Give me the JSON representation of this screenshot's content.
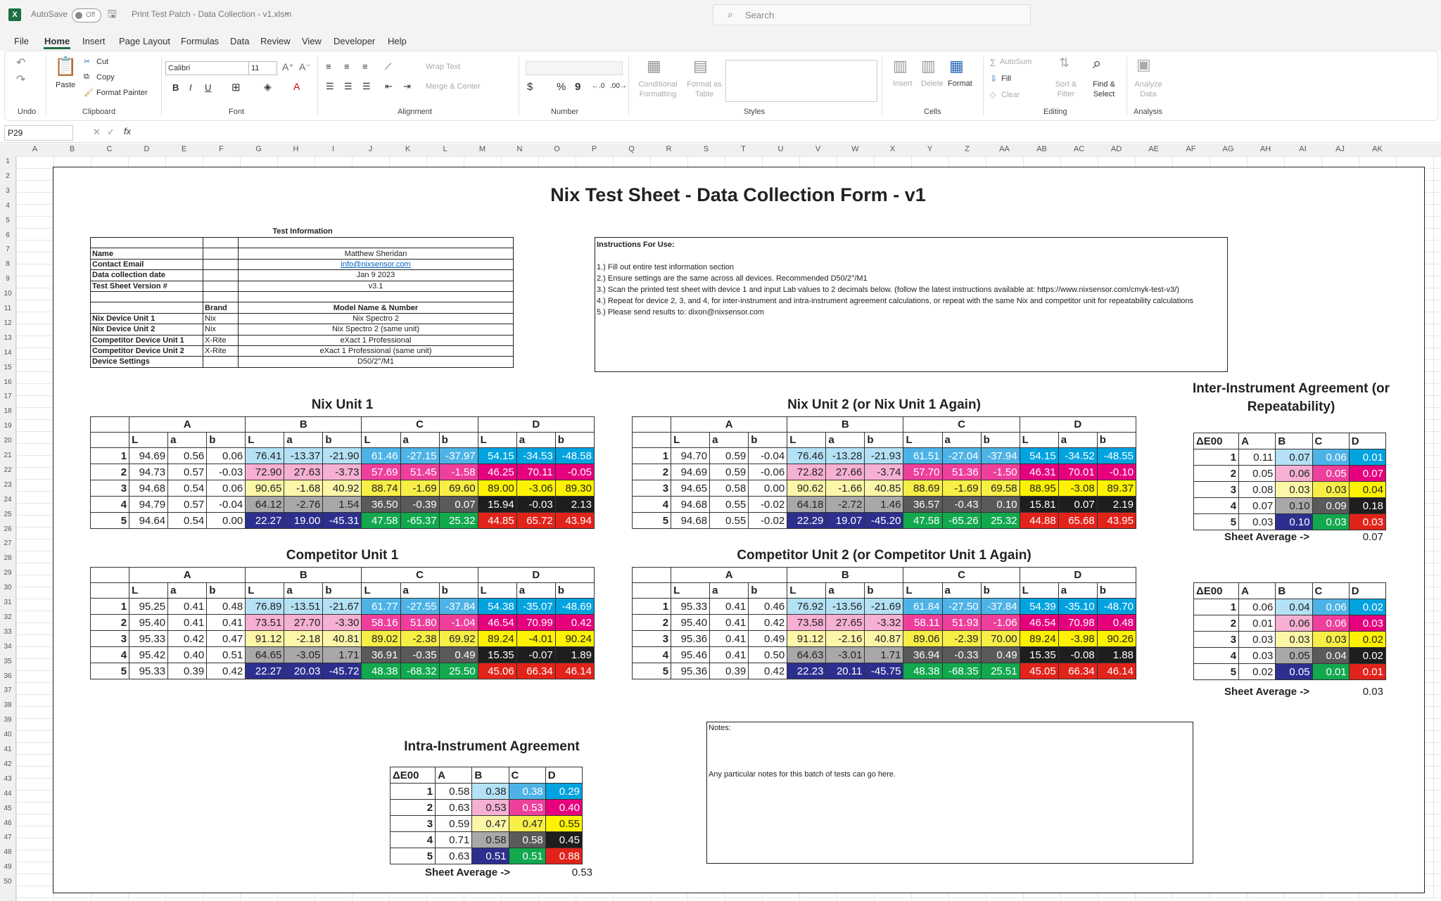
{
  "window": {
    "autosave_label": "AutoSave",
    "autosave_state": "Off",
    "file_name": "Print Test Patch - Data Collection - v1.xlsm",
    "search_placeholder": "Search"
  },
  "menu": [
    "File",
    "Home",
    "Insert",
    "Page Layout",
    "Formulas",
    "Data",
    "Review",
    "View",
    "Developer",
    "Help"
  ],
  "ribbon": {
    "undo_group": "Undo",
    "clipboard": {
      "paste": "Paste",
      "cut": "Cut",
      "copy": "Copy",
      "format_painter": "Format Painter",
      "label": "Clipboard"
    },
    "font": {
      "name": "Calibri",
      "size": "11",
      "label": "Font"
    },
    "alignment": {
      "wrap": "Wrap Text",
      "merge": "Merge & Center",
      "label": "Alignment"
    },
    "number": {
      "label": "Number",
      "currency": "$",
      "percent": "%",
      "comma": "9"
    },
    "styles": {
      "conditional": "Conditional Formatting",
      "format_table": "Format as Table",
      "label": "Styles"
    },
    "cells": {
      "insert": "Insert",
      "delete": "Delete",
      "format": "Format",
      "label": "Cells"
    },
    "editing": {
      "autosum": "AutoSum",
      "fill": "Fill",
      "clear": "Clear",
      "sort": "Sort & Filter",
      "find": "Find & Select",
      "label": "Editing"
    },
    "analysis": {
      "analyze": "Analyze Data",
      "label": "Analysis"
    }
  },
  "formula_bar": {
    "cell_ref": "P29",
    "fx": "fx",
    "value": ""
  },
  "columns": [
    "A",
    "B",
    "C",
    "D",
    "E",
    "F",
    "G",
    "H",
    "I",
    "J",
    "K",
    "L",
    "M",
    "N",
    "O",
    "P",
    "Q",
    "R",
    "S",
    "T",
    "U",
    "V",
    "W",
    "X",
    "Y",
    "Z",
    "AA",
    "AB",
    "AC",
    "AD",
    "AE",
    "AF",
    "AG",
    "AH",
    "AI",
    "AJ",
    "AK"
  ],
  "sheet": {
    "title": "Nix Test Sheet - Data Collection Form - v1",
    "test_info": {
      "heading": "Test Information",
      "name_label": "Name",
      "name": "Matthew Sheridan",
      "email_label": "Contact Email",
      "email": "info@nixsensor.com",
      "date_label": "Data collection date",
      "date": "Jan 9 2023",
      "version_label": "Test Sheet Version #",
      "version": "v3.1",
      "brand_head": "Brand",
      "model_head": "Model Name & Number",
      "devices": [
        {
          "label": "Nix Device Unit 1",
          "brand": "Nix",
          "model": "Nix Spectro 2"
        },
        {
          "label": "Nix Device Unit 2",
          "brand": "Nix",
          "model": "Nix Spectro 2 (same unit)"
        },
        {
          "label": "Competitor Device Unit 1",
          "brand": "X-Rite",
          "model": "eXact 1 Professional"
        },
        {
          "label": "Competitor Device Unit 2",
          "brand": "X-Rite",
          "model": "eXact 1 Professional  (same unit)"
        }
      ],
      "settings_label": "Device Settings",
      "settings": "D50/2°/M1"
    },
    "instructions": {
      "heading": "Instructions For Use:",
      "lines": [
        "1.) Fill out entire test information section",
        "2.) Ensure  settings are the same across all devices. Recommended D50/2°/M1",
        "3.) Scan the printed test sheet with device 1 and input Lab values to 2 decimals below. (follow the latest instructions available at: https://www.nixsensor.com/cmyk-test-v3/)",
        "4.) Repeat for device 2, 3, and 4, for inter-instrument and intra-instrument agreement calculations, or repeat with the same Nix and competitor unit for repeatability calculations",
        "5.) Please send results to: dixon@nixsensor.com"
      ]
    },
    "groups": [
      "A",
      "B",
      "C",
      "D"
    ],
    "lab_headers": [
      "L",
      "a",
      "b"
    ],
    "tables": [
      {
        "title": "Nix Unit 1",
        "rows": [
          [
            "1",
            "94.69",
            "0.56",
            "0.06",
            "76.41",
            "-13.37",
            "-21.90",
            "61.46",
            "-27.15",
            "-37.97",
            "54.15",
            "-34.53",
            "-48.58"
          ],
          [
            "2",
            "94.73",
            "0.57",
            "-0.03",
            "72.90",
            "27.63",
            "-3.73",
            "57.69",
            "51.45",
            "-1.58",
            "46.25",
            "70.11",
            "-0.05"
          ],
          [
            "3",
            "94.68",
            "0.54",
            "0.06",
            "90.65",
            "-1.68",
            "40.92",
            "88.74",
            "-1.69",
            "69.60",
            "89.00",
            "-3.06",
            "89.30"
          ],
          [
            "4",
            "94.79",
            "0.57",
            "-0.04",
            "64.12",
            "-2.76",
            "1.54",
            "36.50",
            "-0.39",
            "0.07",
            "15.94",
            "-0.03",
            "2.13"
          ],
          [
            "5",
            "94.64",
            "0.54",
            "0.00",
            "22.27",
            "19.00",
            "-45.31",
            "47.58",
            "-65.37",
            "25.32",
            "44.85",
            "65.72",
            "43.94"
          ]
        ]
      },
      {
        "title": "Nix Unit 2 (or Nix Unit 1 Again)",
        "rows": [
          [
            "1",
            "94.70",
            "0.59",
            "-0.04",
            "76.46",
            "-13.28",
            "-21.93",
            "61.51",
            "-27.04",
            "-37.94",
            "54.15",
            "-34.52",
            "-48.55"
          ],
          [
            "2",
            "94.69",
            "0.59",
            "-0.06",
            "72.82",
            "27.66",
            "-3.74",
            "57.70",
            "51.36",
            "-1.50",
            "46.31",
            "70.01",
            "-0.10"
          ],
          [
            "3",
            "94.65",
            "0.58",
            "0.00",
            "90.62",
            "-1.66",
            "40.85",
            "88.69",
            "-1.69",
            "69.58",
            "88.95",
            "-3.08",
            "89.37"
          ],
          [
            "4",
            "94.68",
            "0.55",
            "-0.02",
            "64.18",
            "-2.72",
            "1.46",
            "36.57",
            "-0.43",
            "0.10",
            "15.81",
            "0.07",
            "2.19"
          ],
          [
            "5",
            "94.68",
            "0.55",
            "-0.02",
            "22.29",
            "19.07",
            "-45.20",
            "47.58",
            "-65.26",
            "25.32",
            "44.88",
            "65.68",
            "43.95"
          ]
        ]
      },
      {
        "title": "Competitor Unit 1",
        "rows": [
          [
            "1",
            "95.25",
            "0.41",
            "0.48",
            "76.89",
            "-13.51",
            "-21.67",
            "61.77",
            "-27.55",
            "-37.84",
            "54.38",
            "-35.07",
            "-48.69"
          ],
          [
            "2",
            "95.40",
            "0.41",
            "0.41",
            "73.51",
            "27.70",
            "-3.30",
            "58.16",
            "51.80",
            "-1.04",
            "46.54",
            "70.99",
            "0.42"
          ],
          [
            "3",
            "95.33",
            "0.42",
            "0.47",
            "91.12",
            "-2.18",
            "40.81",
            "89.02",
            "-2.38",
            "69.92",
            "89.24",
            "-4.01",
            "90.24"
          ],
          [
            "4",
            "95.42",
            "0.40",
            "0.51",
            "64.65",
            "-3.05",
            "1.71",
            "36.91",
            "-0.35",
            "0.49",
            "15.35",
            "-0.07",
            "1.89"
          ],
          [
            "5",
            "95.33",
            "0.39",
            "0.42",
            "22.27",
            "20.03",
            "-45.72",
            "48.38",
            "-68.32",
            "25.50",
            "45.06",
            "66.34",
            "46.14"
          ]
        ]
      },
      {
        "title": "Competitor Unit 2 (or Competitor Unit 1 Again)",
        "rows": [
          [
            "1",
            "95.33",
            "0.41",
            "0.46",
            "76.92",
            "-13.56",
            "-21.69",
            "61.84",
            "-27.50",
            "-37.84",
            "54.39",
            "-35.10",
            "-48.70"
          ],
          [
            "2",
            "95.40",
            "0.41",
            "0.42",
            "73.58",
            "27.65",
            "-3.32",
            "58.11",
            "51.93",
            "-1.06",
            "46.54",
            "70.98",
            "0.48"
          ],
          [
            "3",
            "95.36",
            "0.41",
            "0.49",
            "91.12",
            "-2.16",
            "40.87",
            "89.06",
            "-2.39",
            "70.00",
            "89.24",
            "-3.98",
            "90.26"
          ],
          [
            "4",
            "95.46",
            "0.41",
            "0.50",
            "64.63",
            "-3.01",
            "1.71",
            "36.94",
            "-0.33",
            "0.49",
            "15.35",
            "-0.08",
            "1.88"
          ],
          [
            "5",
            "95.36",
            "0.39",
            "0.42",
            "22.23",
            "20.11",
            "-45.75",
            "48.38",
            "-68.35",
            "25.51",
            "45.05",
            "66.34",
            "46.14"
          ]
        ]
      }
    ],
    "inter": {
      "title": "Inter-Instrument Agreement (or Repeatability)",
      "de_head": "ΔE00",
      "rows1": [
        [
          "1",
          "0.11",
          "0.07",
          "0.06",
          "0.01"
        ],
        [
          "2",
          "0.05",
          "0.06",
          "0.05",
          "0.07"
        ],
        [
          "3",
          "0.08",
          "0.03",
          "0.03",
          "0.04"
        ],
        [
          "4",
          "0.07",
          "0.10",
          "0.09",
          "0.18"
        ],
        [
          "5",
          "0.03",
          "0.10",
          "0.03",
          "0.03"
        ]
      ],
      "avg_label": "Sheet Average ->",
      "avg1": "0.07",
      "rows2": [
        [
          "1",
          "0.06",
          "0.04",
          "0.06",
          "0.02"
        ],
        [
          "2",
          "0.01",
          "0.06",
          "0.06",
          "0.03"
        ],
        [
          "3",
          "0.03",
          "0.03",
          "0.03",
          "0.02"
        ],
        [
          "4",
          "0.03",
          "0.05",
          "0.04",
          "0.02"
        ],
        [
          "5",
          "0.02",
          "0.05",
          "0.01",
          "0.01"
        ]
      ],
      "avg2": "0.03"
    },
    "intra": {
      "title": "Intra-Instrument Agreement",
      "de_head": "ΔE00",
      "rows": [
        [
          "1",
          "0.58",
          "0.38",
          "0.38",
          "0.29"
        ],
        [
          "2",
          "0.63",
          "0.53",
          "0.53",
          "0.40"
        ],
        [
          "3",
          "0.59",
          "0.47",
          "0.47",
          "0.55"
        ],
        [
          "4",
          "0.71",
          "0.58",
          "0.58",
          "0.45"
        ],
        [
          "5",
          "0.63",
          "0.51",
          "0.51",
          "0.88"
        ]
      ],
      "avg_label": "Sheet Average ->",
      "avg": "0.53"
    },
    "notes": {
      "label": "Notes:",
      "text": "Any particular notes for this batch of tests can go here."
    },
    "patch_colors": {
      "B": [
        "#b4e1f5",
        "#f6b0d3",
        "#fbf6a8",
        "#a8a8a8",
        "#2c2f8e"
      ],
      "C": [
        "#4db3e6",
        "#ee3f9c",
        "#f7ee46",
        "#5a5a5a",
        "#11a84e"
      ],
      "D": [
        "#00a3e0",
        "#e6007e",
        "#fff200",
        "#1e1e1e",
        "#e2231a"
      ],
      "D_text_dark": [
        false,
        false,
        true,
        false,
        false
      ],
      "C_text_dark": [
        false,
        false,
        true,
        false,
        false
      ],
      "B_text_dark": [
        true,
        true,
        true,
        true,
        false
      ]
    }
  }
}
